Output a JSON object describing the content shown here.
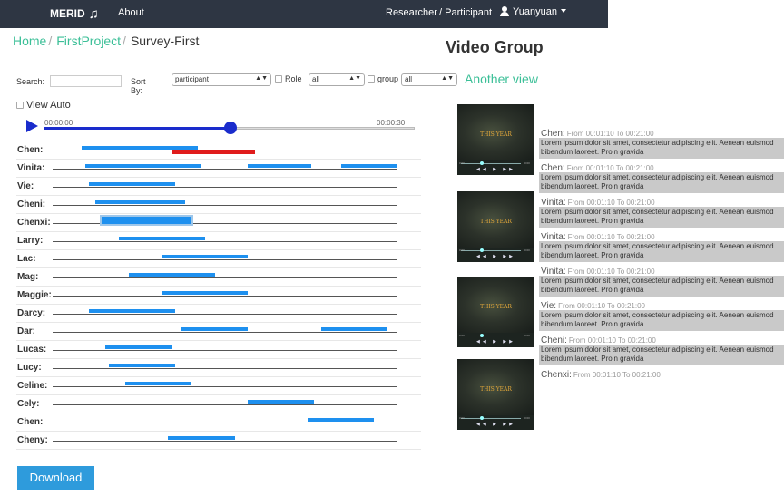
{
  "nav": {
    "brand": "MERID",
    "brand_icon": "music-note-icon",
    "about": "About",
    "researcher": "Researcher",
    "participant": "/ Participant",
    "user": "Yuanyuan"
  },
  "breadcrumb": {
    "home": "Home",
    "project": "FirstProject",
    "current": "Survey-First"
  },
  "filters": {
    "search_label": "Search:",
    "search_value": "",
    "sortby_label": "Sort By:",
    "sortby_value": "participant",
    "role_label": "Role",
    "role_checked": false,
    "role_value": "all",
    "group_label": "group",
    "group_checked": false,
    "group_value": "all",
    "another_view": "Another view"
  },
  "view_auto": {
    "label": "View Auto",
    "checked": false
  },
  "player": {
    "start_time": "00:00:00",
    "end_time": "00:00:30",
    "progress": 0.5
  },
  "colors": {
    "accent": "#3bbf97",
    "segment": "#1e90ef",
    "highlight": "#e01c1c",
    "navbar": "#2e3643",
    "play": "#1a2ccc"
  },
  "timeline": [
    {
      "name": "Chen:",
      "segments": [
        [
          0.05,
          0.4
        ]
      ],
      "extra": [
        [
          0.32,
          0.57
        ]
      ]
    },
    {
      "name": "Vinita:",
      "segments": [
        [
          0.06,
          0.41
        ],
        [
          0.55,
          0.74
        ],
        [
          0.83,
          1.0
        ]
      ]
    },
    {
      "name": "Vie:",
      "segments": [
        [
          0.07,
          0.33
        ]
      ]
    },
    {
      "name": "Cheni:",
      "segments": [
        [
          0.09,
          0.36
        ]
      ]
    },
    {
      "name": "Chenxi:",
      "segments": [
        [
          0.11,
          0.38
        ]
      ],
      "selected": true
    },
    {
      "name": "Larry:",
      "segments": [
        [
          0.16,
          0.42
        ]
      ]
    },
    {
      "name": "Lac:",
      "segments": [
        [
          0.29,
          0.55
        ]
      ]
    },
    {
      "name": "Mag:",
      "segments": [
        [
          0.19,
          0.45
        ]
      ]
    },
    {
      "name": "Maggie:",
      "segments": [
        [
          0.29,
          0.55
        ]
      ]
    },
    {
      "name": "Darcy:",
      "segments": [
        [
          0.07,
          0.33
        ]
      ]
    },
    {
      "name": "Dar:",
      "segments": [
        [
          0.35,
          0.55
        ],
        [
          0.77,
          0.97
        ]
      ]
    },
    {
      "name": "Lucas:",
      "segments": [
        [
          0.12,
          0.32
        ]
      ]
    },
    {
      "name": "Lucy:",
      "segments": [
        [
          0.13,
          0.33
        ]
      ]
    },
    {
      "name": "Celine:",
      "segments": [
        [
          0.18,
          0.38
        ]
      ]
    },
    {
      "name": "Cely:",
      "segments": [
        [
          0.55,
          0.75
        ]
      ]
    },
    {
      "name": "Chen:",
      "segments": [
        [
          0.73,
          0.93
        ]
      ]
    },
    {
      "name": "Cheny:",
      "segments": [
        [
          0.31,
          0.51
        ]
      ]
    }
  ],
  "download_label": "Download",
  "video_group": {
    "title": "Video Group",
    "video_title": "THIS YEAR",
    "thumb_time_start": "0:00",
    "thumb_time_end": "0:00",
    "thumb_controls": "◀◀ ▶ ▶▶",
    "thumbnails": 4
  },
  "comments": [
    {
      "name": "Chen:",
      "range": "From 00:01:10 To 00:21:00",
      "text": "Lorem ipsum dolor sit amet, consectetur adipiscing elit. Aenean euismod bibendum laoreet. Proin gravida"
    },
    {
      "name": "Chen:",
      "range": "From 00:01:10 To 00:21:00",
      "text": "Lorem ipsum dolor sit amet, consectetur adipiscing elit. Aenean euismod bibendum laoreet. Proin gravida"
    },
    {
      "name": "Vinita:",
      "range": "From 00:01:10 To 00:21:00",
      "text": "Lorem ipsum dolor sit amet, consectetur adipiscing elit. Aenean euismod bibendum laoreet. Proin gravida"
    },
    {
      "name": "Vinita:",
      "range": "From 00:01:10 To 00:21:00",
      "text": "Lorem ipsum dolor sit amet, consectetur adipiscing elit. Aenean euismod bibendum laoreet. Proin gravida"
    },
    {
      "name": "Vinita:",
      "range": "From 00:01:10 To 00:21:00",
      "text": "Lorem ipsum dolor sit amet, consectetur adipiscing elit. Aenean euismod bibendum laoreet. Proin gravida"
    },
    {
      "name": "Vie:",
      "range": "From 00:01:10 To 00:21:00",
      "text": "Lorem ipsum dolor sit amet, consectetur adipiscing elit. Aenean euismod bibendum laoreet. Proin gravida"
    },
    {
      "name": "Cheni:",
      "range": "From 00:01:10 To 00:21:00",
      "text": "Lorem ipsum dolor sit amet, consectetur adipiscing elit. Aenean euismod bibendum laoreet. Proin gravida"
    },
    {
      "name": "Chenxi:",
      "range": "From 00:01:10 To 00:21:00",
      "text": ""
    }
  ]
}
